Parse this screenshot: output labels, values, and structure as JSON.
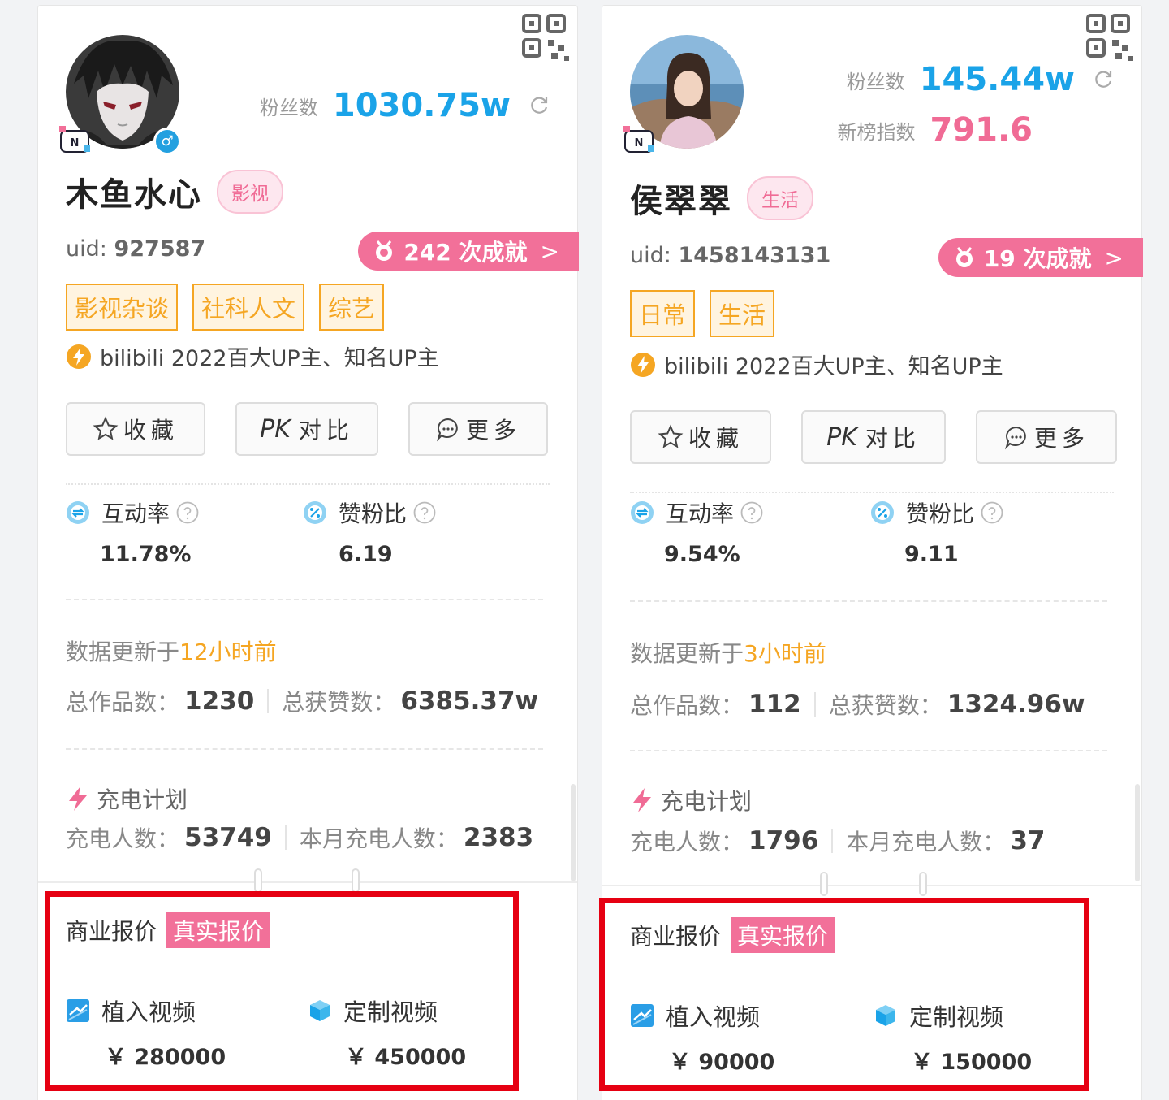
{
  "cards": [
    {
      "name": "木鱼水心",
      "category": "影视",
      "fans_label": "粉丝数",
      "fans": "1030.75w",
      "uid_label": "uid:",
      "uid": "927587",
      "achievements": "242 次成就",
      "tags": [
        "影视杂谈",
        "社科人文",
        "综艺"
      ],
      "cert": "bilibili 2022百大UP主、知名UP主",
      "buttons": {
        "fav": "收藏",
        "pk_prefix": "PK",
        "compare": "对比",
        "more": "更多"
      },
      "interaction_rate_label": "互动率",
      "interaction_rate": "11.78%",
      "like_fan_label": "赞粉比",
      "like_fan": "6.19",
      "updated_prefix": "数据更新于",
      "updated_time": "12小时前",
      "works_label": "总作品数：",
      "works": "1230",
      "likes_label": "总获赞数：",
      "likes": "6385.37w",
      "charge_title": "充电计划",
      "chargers_label": "充电人数：",
      "chargers": "53749",
      "month_chargers_label": "本月充电人数：",
      "month_chargers": "2383",
      "biz_title": "商业报价",
      "biz_real": "真实报价",
      "embed_label": "植入视频",
      "embed_price": "￥ 280000",
      "custom_label": "定制视频",
      "custom_price": "￥ 450000"
    },
    {
      "name": "侯翠翠",
      "category": "生活",
      "fans_label": "粉丝数",
      "fans": "145.44w",
      "index_label": "新榜指数",
      "index": "791.6",
      "uid_label": "uid:",
      "uid": "1458143131",
      "achievements": "19 次成就",
      "tags": [
        "日常",
        "生活"
      ],
      "cert": "bilibili 2022百大UP主、知名UP主",
      "buttons": {
        "fav": "收藏",
        "pk_prefix": "PK",
        "compare": "对比",
        "more": "更多"
      },
      "interaction_rate_label": "互动率",
      "interaction_rate": "9.54%",
      "like_fan_label": "赞粉比",
      "like_fan": "9.11",
      "updated_prefix": "数据更新于",
      "updated_time": "3小时前",
      "works_label": "总作品数：",
      "works": "112",
      "likes_label": "总获赞数：",
      "likes": "1324.96w",
      "charge_title": "充电计划",
      "chargers_label": "充电人数：",
      "chargers": "1796",
      "month_chargers_label": "本月充电人数：",
      "month_chargers": "37",
      "biz_title": "商业报价",
      "biz_real": "真实报价",
      "embed_label": "植入视频",
      "embed_price": "￥ 90000",
      "custom_label": "定制视频",
      "custom_price": "￥ 150000"
    }
  ],
  "colors": {
    "fans": "#1aa3e8",
    "index": "#f06b95",
    "achievement_bg": "#f27099",
    "tag": "#f5a623",
    "highlight_box": "#e60012"
  }
}
